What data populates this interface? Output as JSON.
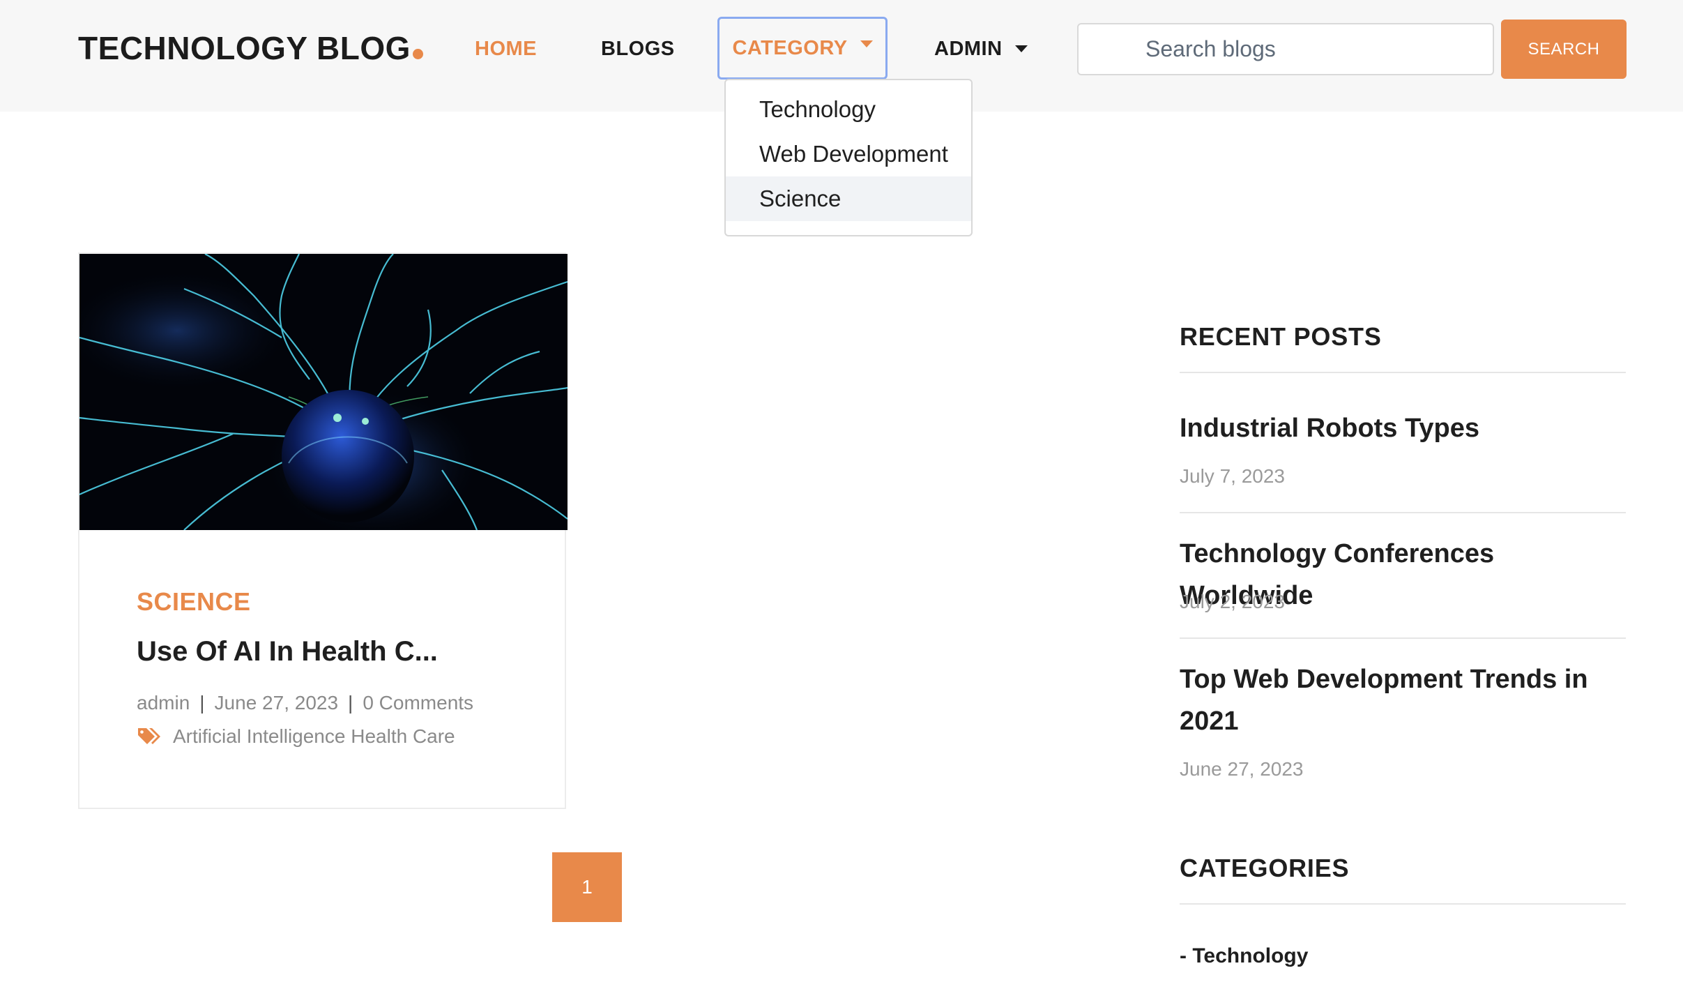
{
  "header": {
    "logo_text": "TECHNOLOGY BLOG",
    "nav": {
      "home": "HOME",
      "blogs": "BLOGS",
      "category": "CATEGORY",
      "admin": "ADMIN"
    },
    "search": {
      "placeholder": "Search blogs",
      "button_label": "SEARCH"
    }
  },
  "category_dropdown": {
    "items": [
      "Technology",
      "Web Development",
      "Science"
    ],
    "hovered": "Science"
  },
  "post_card": {
    "category": "SCIENCE",
    "title": "Use Of AI In Health C...",
    "author": "admin",
    "date": "June 27, 2023",
    "comments": "0 Comments",
    "tags": "Artificial Intelligence Health Care",
    "image_alt": "plasma-ball"
  },
  "pagination": {
    "current": "1"
  },
  "sidebar": {
    "recent_heading": "RECENT POSTS",
    "recent_posts": [
      {
        "title": "Industrial Robots Types",
        "date": "July 7, 2023"
      },
      {
        "title": "Technology Conferences Worldwide",
        "date": "July 2, 2023"
      },
      {
        "title": "Top Web Development Trends in 2021",
        "date": "June 27, 2023"
      }
    ],
    "categories_heading": "CATEGORIES",
    "categories": [
      "- Technology"
    ]
  },
  "colors": {
    "accent": "#e8894a",
    "header_bg": "#f7f7f7",
    "focus_ring": "#8aaaf0"
  }
}
